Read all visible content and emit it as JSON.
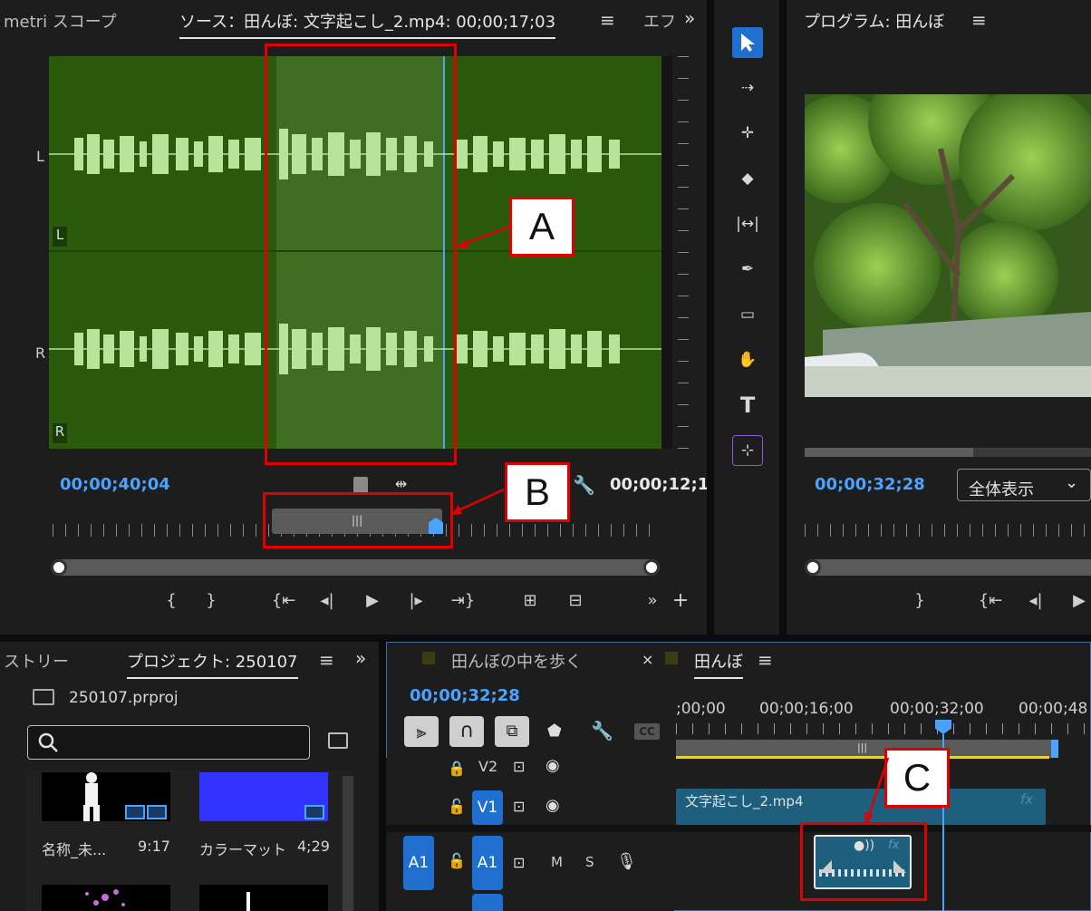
{
  "source_panel": {
    "tab_left": "metri スコープ",
    "tab_active": "ソース：田んぼ: 文字起こし_2.mp4: 00;00;17;03",
    "tab_right": "エフ",
    "channel_L": "L",
    "channel_L_small": "L",
    "channel_R": "R",
    "channel_R_small": "R",
    "timecode_left": "00;00;40;04",
    "timecode_right": "00;00;12;1"
  },
  "program_panel": {
    "tab": "プログラム: 田んぼ",
    "timecode": "00;00;32;28",
    "zoom_select": "全体表示"
  },
  "project_panel": {
    "tab_left": "ストリー",
    "tab_active": "プロジェクト: 250107",
    "file_name": "250107.prproj",
    "search_placeholder": "",
    "items": [
      {
        "name": "名称_未...",
        "duration": "9:17"
      },
      {
        "name": "カラーマット",
        "duration": "4;29"
      }
    ]
  },
  "timeline_panel": {
    "tab_inactive": "田んぼの中を歩く",
    "tab_close": "×",
    "tab_active": "田んぼ",
    "timecode": "00;00;32;28",
    "ruler_labels": [
      ";00;00",
      "00;00;16;00",
      "00;00;32;00",
      "00;00;48"
    ],
    "cc_label": "CC",
    "tracks": {
      "v2": "V2",
      "v1": "V1",
      "a1_left": "A1",
      "a1": "A1",
      "mute": "M",
      "solo": "S"
    },
    "clip_name": "文字起こし_2.mp4",
    "clip_fx": "fx"
  },
  "callouts": {
    "a": "A",
    "b": "B",
    "c": "C"
  },
  "colors": {
    "waveform_bg": "#2b5a0c",
    "waveform_selected": "#3f6e23",
    "waveform": "#b7e39b",
    "accent_blue": "#4aa3ff",
    "callout_red": "#e00000"
  }
}
